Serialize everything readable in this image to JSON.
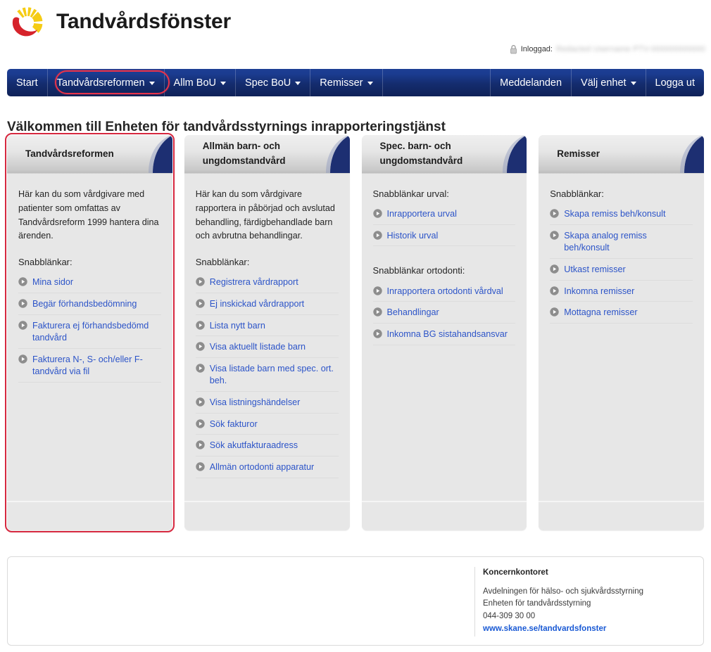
{
  "header": {
    "brand_title": "Tandvårdsfönster",
    "logo_icon": "region-skane-sun-logo",
    "login": {
      "icon": "lock-icon",
      "label": "Inloggad:",
      "user": "Redacted Username  PTV-000000000000",
      "redacted": true
    }
  },
  "nav": {
    "left_items": [
      {
        "label": "Start",
        "has_caret": false,
        "highlighted": false
      },
      {
        "label": "Tandvårdsreformen",
        "has_caret": true,
        "highlighted": true
      },
      {
        "label": "Allm BoU",
        "has_caret": true,
        "highlighted": false
      },
      {
        "label": "Spec BoU",
        "has_caret": true,
        "highlighted": false
      },
      {
        "label": "Remisser",
        "has_caret": true,
        "highlighted": false
      }
    ],
    "right_items": [
      {
        "label": "Meddelanden",
        "has_caret": false
      },
      {
        "label": "Välj enhet",
        "has_caret": true
      },
      {
        "label": "Logga ut",
        "has_caret": false
      }
    ]
  },
  "page_heading": "Välkommen till Enheten för tandvårdsstyrnings inrapporteringstjänst",
  "cards": [
    {
      "title": "Tandvårdsreformen",
      "selected": true,
      "description": "Här kan du som vårdgivare med patienter som omfattas av Tandvårdsreform 1999 hantera dina ärenden.",
      "sections": [
        {
          "subhead": "Snabblänkar:",
          "links": [
            "Mina sidor",
            "Begär förhandsbedömning",
            "Fakturera ej förhandsbedömd tandvård",
            "Fakturera N-, S- och/eller F-tandvård via fil"
          ]
        }
      ]
    },
    {
      "title": "Allmän barn- och ungdomstandvård",
      "selected": false,
      "description": "Här kan du som vårdgivare rapportera in påbörjad och avslutad behandling, färdigbehandlade barn och avbrutna behandlingar.",
      "sections": [
        {
          "subhead": "Snabblänkar:",
          "links": [
            "Registrera vårdrapport",
            "Ej inskickad vårdrapport",
            "Lista nytt barn",
            "Visa aktuellt listade barn",
            "Visa listade barn med spec. ort. beh.",
            "Visa listningshändelser",
            "Sök fakturor",
            "Sök akutfakturaadress",
            "Allmän ortodonti apparatur"
          ]
        }
      ]
    },
    {
      "title": "Spec. barn- och ungdomstandvård",
      "selected": false,
      "description": "",
      "sections": [
        {
          "subhead": "Snabblänkar urval:",
          "links": [
            "Inrapportera urval",
            "Historik urval"
          ]
        },
        {
          "subhead": "Snabblänkar ortodonti:",
          "links": [
            "Inrapportera ortodonti vårdval",
            "Behandlingar",
            "Inkomna BG sistahandsansvar"
          ]
        }
      ]
    },
    {
      "title": "Remisser",
      "selected": false,
      "description": "",
      "sections": [
        {
          "subhead": "Snabblänkar:",
          "links": [
            "Skapa remiss beh/konsult",
            "Skapa analog remiss beh/konsult",
            "Utkast remisser",
            "Inkomna remisser",
            "Mottagna remisser"
          ]
        }
      ]
    }
  ],
  "footer": {
    "title": "Koncernkontoret",
    "lines": [
      "Avdelningen för hälso- och sjukvårdsstyrning",
      "Enheten för tandvårdsstyrning",
      "044-309 30 00"
    ],
    "url": "www.skane.se/tandvardsfonster"
  },
  "colors": {
    "nav_blue": "#16307a",
    "link_blue": "#2c54c8",
    "highlight_red": "#e8334a",
    "selected_red": "#d6283f",
    "card_bg": "#e7e7e7",
    "logo_yellow": "#f5cc15",
    "logo_red": "#d6232b",
    "fold_navy": "#1d2f72"
  }
}
